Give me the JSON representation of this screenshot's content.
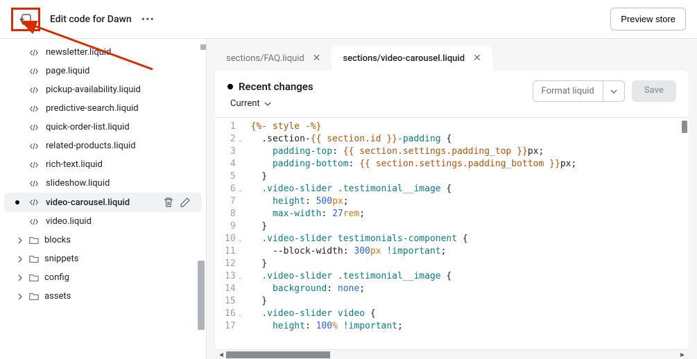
{
  "header": {
    "title": "Edit code for Dawn",
    "preview_label": "Preview store"
  },
  "sidebar": {
    "files": [
      {
        "name": "newsletter.liquid",
        "active": false,
        "dot": false
      },
      {
        "name": "page.liquid",
        "active": false,
        "dot": false
      },
      {
        "name": "pickup-availability.liquid",
        "active": false,
        "dot": false
      },
      {
        "name": "predictive-search.liquid",
        "active": false,
        "dot": false
      },
      {
        "name": "quick-order-list.liquid",
        "active": false,
        "dot": false
      },
      {
        "name": "related-products.liquid",
        "active": false,
        "dot": false
      },
      {
        "name": "rich-text.liquid",
        "active": false,
        "dot": false
      },
      {
        "name": "slideshow.liquid",
        "active": false,
        "dot": false
      },
      {
        "name": "video-carousel.liquid",
        "active": true,
        "dot": true
      },
      {
        "name": "video.liquid",
        "active": false,
        "dot": false
      }
    ],
    "folders": [
      {
        "name": "blocks"
      },
      {
        "name": "snippets"
      },
      {
        "name": "config"
      },
      {
        "name": "assets"
      }
    ]
  },
  "tabs": [
    {
      "label": "sections/FAQ.liquid",
      "active": false
    },
    {
      "label": "sections/video-carousel.liquid",
      "active": true
    }
  ],
  "editor": {
    "changes_label": "Recent changes",
    "current_label": "Current",
    "format_label": "Format liquid",
    "save_label": "Save"
  },
  "code_lines": [
    {
      "n": 1,
      "fold": false
    },
    {
      "n": 2,
      "fold": true
    },
    {
      "n": 3,
      "fold": false
    },
    {
      "n": 4,
      "fold": false
    },
    {
      "n": 5,
      "fold": false
    },
    {
      "n": 6,
      "fold": true
    },
    {
      "n": 7,
      "fold": false
    },
    {
      "n": 8,
      "fold": false
    },
    {
      "n": 9,
      "fold": false
    },
    {
      "n": 10,
      "fold": true
    },
    {
      "n": 11,
      "fold": false
    },
    {
      "n": 12,
      "fold": false
    },
    {
      "n": 13,
      "fold": true
    },
    {
      "n": 14,
      "fold": false
    },
    {
      "n": 15,
      "fold": false
    },
    {
      "n": 16,
      "fold": true
    },
    {
      "n": 17,
      "fold": false
    }
  ],
  "code_source": [
    "{%- style -%}",
    "  .section-{{ section.id }}-padding {",
    "    padding-top: {{ section.settings.padding_top }}px;",
    "    padding-bottom: {{ section.settings.padding_bottom }}px;",
    "  }",
    "  .video-slider .testimonial__image {",
    "    height: 500px;",
    "    max-width: 27rem;",
    "  }",
    "  .video-slider testimonials-component {",
    "    --block-width: 300px !important;",
    "  }",
    "  .video-slider .testimonial__image {",
    "    background: none;",
    "  }",
    "  .video-slider video {",
    "    height: 100% !important;"
  ]
}
